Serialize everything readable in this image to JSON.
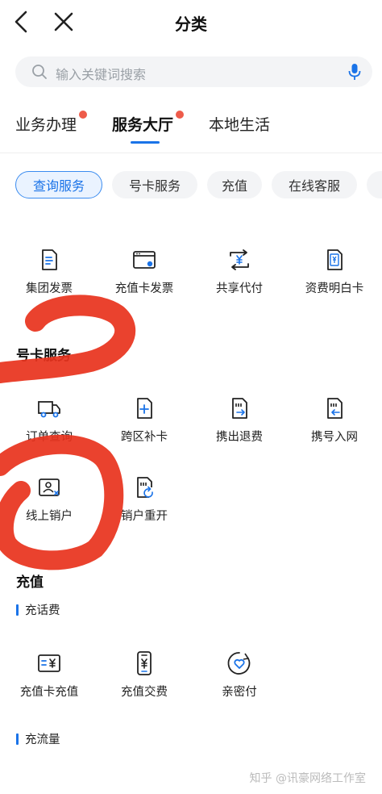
{
  "header": {
    "title": "分类"
  },
  "search": {
    "placeholder": "输入关键词搜索"
  },
  "tabs": [
    {
      "label": "业务办理",
      "dot": true
    },
    {
      "label": "服务大厅",
      "dot": true,
      "active": true
    },
    {
      "label": "本地生活",
      "dot": false
    }
  ],
  "chips": [
    {
      "label": "查询服务",
      "active": true
    },
    {
      "label": "号卡服务"
    },
    {
      "label": "充值"
    },
    {
      "label": "在线客服"
    }
  ],
  "query_items": [
    {
      "label": "集团发票",
      "icon": "document-icon"
    },
    {
      "label": "充值卡发票",
      "icon": "browser-card-icon"
    },
    {
      "label": "共享代付",
      "icon": "yuan-exchange-icon"
    },
    {
      "label": "资费明白卡",
      "icon": "sim-yuan-icon"
    }
  ],
  "sections": {
    "card_service": "号卡服务",
    "recharge": "充值",
    "phone_fee": "充话费",
    "data_traffic": "充流量"
  },
  "card_items": [
    {
      "label": "订单查询",
      "icon": "delivery-truck-icon"
    },
    {
      "label": "跨区补卡",
      "icon": "sim-add-icon"
    },
    {
      "label": "携出退费",
      "icon": "sim-transfer-out-icon"
    },
    {
      "label": "携号入网",
      "icon": "sim-transfer-in-icon"
    }
  ],
  "card_items2": [
    {
      "label": "线上销户",
      "icon": "account-cancel-icon"
    },
    {
      "label": "销户重开",
      "icon": "sim-reopen-icon"
    }
  ],
  "recharge_items": [
    {
      "label": "充值卡充值",
      "icon": "card-yuan-icon"
    },
    {
      "label": "充值交费",
      "icon": "phone-yuan-icon"
    },
    {
      "label": "亲密付",
      "icon": "heart-badge-icon"
    }
  ],
  "watermark": "知乎 @讯豪网络工作室",
  "colors": {
    "accent": "#1a73e8",
    "dot": "#ee5b4a",
    "scribble": "#e8321c"
  }
}
